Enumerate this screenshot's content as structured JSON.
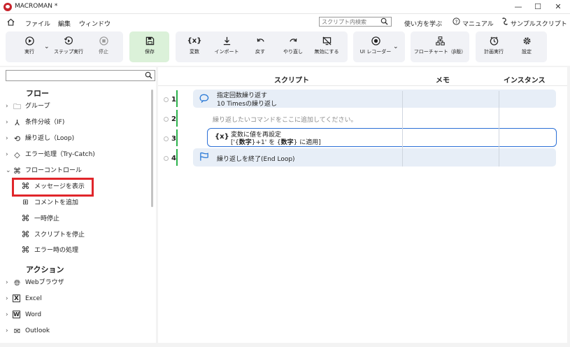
{
  "window": {
    "title": "MACROMAN *",
    "minimize": "—",
    "maximize": "☐",
    "close": "✕"
  },
  "menu": {
    "items": [
      "ファイル",
      "編集",
      "ウィンドウ"
    ],
    "search_placeholder": "スクリプト内検索",
    "learn": "使い方を学ぶ",
    "manual": "マニュアル",
    "sample": "サンプルスクリプト"
  },
  "toolbar": {
    "run": "実行",
    "step": "ステップ実行",
    "stop": "停止",
    "save": "保存",
    "variable": "変数",
    "import": "インポート",
    "undo": "戻す",
    "redo": "やり直し",
    "disable": "無効にする",
    "ui_recorder": "UI レコーダー",
    "flowchart": "フローチャート（β版）",
    "schedule": "計画実行",
    "settings": "設定"
  },
  "sidebar": {
    "flow_title": "フロー",
    "flow_items": [
      "グループ",
      "条件分岐（IF)",
      "繰り返し（Loop)",
      "エラー処理（Try-Catch)",
      "フローコントロール"
    ],
    "flow_control_items": [
      "メッセージを表示",
      "コメントを追加",
      "一時停止",
      "スクリプトを停止",
      "エラー時の処理"
    ],
    "action_title": "アクション",
    "action_items": [
      "Webブラウザ",
      "Excel",
      "Word",
      "Outlook"
    ]
  },
  "main": {
    "columns": [
      "スクリプト",
      "メモ",
      "インスタンス"
    ],
    "rows": [
      {
        "num": "1",
        "title": "指定回数繰り返す",
        "sub": "10 Timesの繰り返し"
      },
      {
        "num": "2",
        "placeholder": "繰り返したいコマンドをここに追加してください。"
      },
      {
        "num": "3",
        "title": "変数に値を再設定",
        "sub_pre": "['{",
        "sub_b1": "数字",
        "sub_mid": "}+1' を {",
        "sub_b2": "数字",
        "sub_post": "} に適用]"
      },
      {
        "num": "4",
        "title": "繰り返しを終了(End Loop)"
      }
    ]
  }
}
